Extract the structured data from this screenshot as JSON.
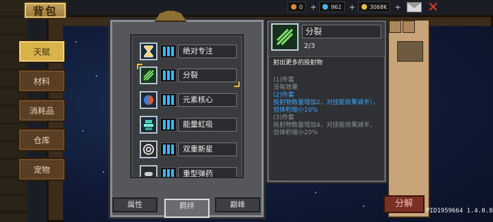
{
  "header": {
    "title": "背包"
  },
  "currencies": [
    {
      "name": "gem",
      "icon": "gem-icon",
      "value": "0",
      "color": "#e08a2a"
    },
    {
      "name": "blue-coin",
      "icon": "blue-coin-icon",
      "value": "962",
      "color": "#4cb4ff"
    },
    {
      "name": "gold",
      "icon": "gold-coin-icon",
      "value": "3068K",
      "color": "#e8c23a"
    }
  ],
  "category_tabs": [
    {
      "label": "天赋",
      "active": true
    },
    {
      "label": "材料",
      "active": false
    },
    {
      "label": "消耗品",
      "active": false
    },
    {
      "label": "仓库",
      "active": false
    },
    {
      "label": "宠物",
      "active": false
    }
  ],
  "talents": [
    {
      "label": "绝对专注",
      "icon": "hourglass-icon",
      "selected": false
    },
    {
      "label": "分裂",
      "icon": "split-arrows-icon",
      "selected": true
    },
    {
      "label": "元素核心",
      "icon": "element-core-icon",
      "selected": false
    },
    {
      "label": "能量虹吸",
      "icon": "energy-siphon-icon",
      "selected": false
    },
    {
      "label": "双重新星",
      "icon": "double-nova-icon",
      "selected": false
    },
    {
      "label": "重型弹药",
      "icon": "heavy-ammo-icon",
      "selected": false
    }
  ],
  "bottom_tabs": [
    {
      "label": "属性",
      "active": false
    },
    {
      "label": "羁绊",
      "active": true
    },
    {
      "label": "巅峰",
      "active": false
    }
  ],
  "detail": {
    "icon": "split-arrows-icon",
    "name": "分裂",
    "level": "2/3",
    "description": "射出更多的投射物",
    "levels": [
      {
        "title": "(1)件套",
        "text": "没有效果",
        "active": false
      },
      {
        "title": "(2)件套",
        "text": "投射物数量增加2，对技能效果减半），但体积缩小10%",
        "active": true
      },
      {
        "title": "(3)件套",
        "text": "投射物数量增加4，对技能效果减半，但体积缩小20%",
        "active": false
      }
    ]
  },
  "inventory": {
    "decompose_label": "分解"
  },
  "footer": {
    "version": "PID1959664 1.4.0.8"
  },
  "colors": {
    "accent": "#f3c22f",
    "active_level": "#3fa7ff",
    "close": "#e03a2b"
  }
}
